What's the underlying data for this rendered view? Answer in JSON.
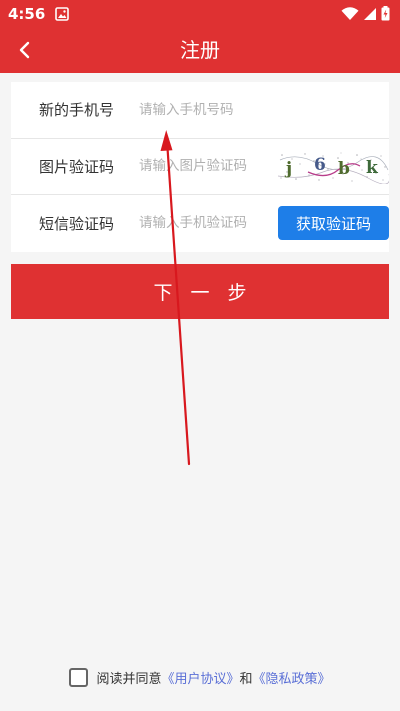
{
  "status_bar": {
    "time": "4:56"
  },
  "header": {
    "title": "注册"
  },
  "form": {
    "rows": [
      {
        "label": "新的手机号",
        "placeholder": "请输入手机号码"
      },
      {
        "label": "图片验证码",
        "placeholder": "请输入图片验证码"
      },
      {
        "label": "短信验证码",
        "placeholder": "请输入手机验证码"
      }
    ],
    "captcha_text": "j6bk",
    "get_code_label": "获取验证码"
  },
  "next_button": {
    "label": "下一步"
  },
  "agreement": {
    "prefix": "阅读并同意",
    "user_agreement": "《用户协议》",
    "conjunction": "和",
    "privacy_policy": "《隐私政策》"
  },
  "colors": {
    "brand_red": "#df3132",
    "button_blue": "#1e7ee8",
    "link_blue": "#5a6fd6",
    "annotation_arrow": "#d8181e"
  }
}
